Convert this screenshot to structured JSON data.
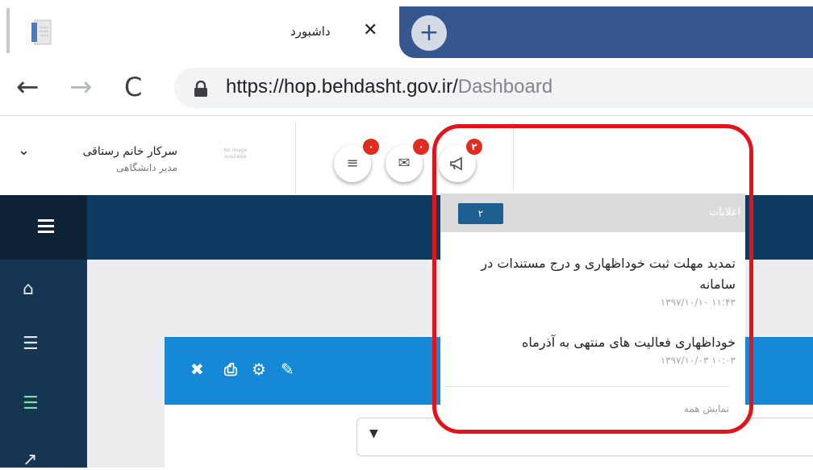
{
  "browser": {
    "tab_title": "داشبورد",
    "close_glyph": "✕",
    "new_tab_glyph": "+",
    "url_host": "https://hop.behdasht.gov.ir/",
    "url_path": "Dashboard",
    "back_glyph": "←",
    "forward_glyph": "→",
    "reload_glyph": "C"
  },
  "header": {
    "user_name": "سرکار خانم  رستاقی",
    "user_role": "مدیر دانشگاهی",
    "avatar_text": "No image available",
    "chevron": "⌄",
    "buttons": [
      {
        "name": "menu",
        "glyph": "≡",
        "badge": "۰"
      },
      {
        "name": "mail",
        "glyph": "✉",
        "badge": "۰"
      },
      {
        "name": "announcements",
        "glyph": "📢",
        "badge": "۲"
      }
    ]
  },
  "sidebar": {
    "icons": [
      "home-icon",
      "list-icon",
      "list-active-icon",
      "chart-icon"
    ],
    "glyphs": [
      "⌂",
      "☰",
      "☰",
      "↗"
    ],
    "active_color": "#7ee0a0"
  },
  "card": {
    "tools": [
      {
        "name": "close",
        "glyph": "✖"
      },
      {
        "name": "print",
        "glyph": "⎙"
      },
      {
        "name": "settings",
        "glyph": "⚙"
      },
      {
        "name": "edit",
        "glyph": "✎"
      }
    ],
    "select_arrow": "▼"
  },
  "notifications": {
    "title": "اعلانات",
    "count": "۲",
    "items": [
      {
        "text": "تمدید مهلت ثبت خوداظهاری و درج مستندات در سامانه",
        "time": "۱۱:۴۳ ۱۳۹۷/۱۰/۱۰"
      },
      {
        "text": "خوداظهاری فعالیت های منتهی به آذرماه",
        "time": "۱۰:۰۳ ۱۳۹۷/۱۰/۰۳"
      }
    ],
    "show_all": "نمایش همه"
  },
  "colors": {
    "browser_accent": "#35568f",
    "sidebar": "#163552",
    "topbar": "#103b60",
    "card_header": "#1589d6",
    "badge": "#e02b20",
    "highlight": "#e3131c"
  }
}
